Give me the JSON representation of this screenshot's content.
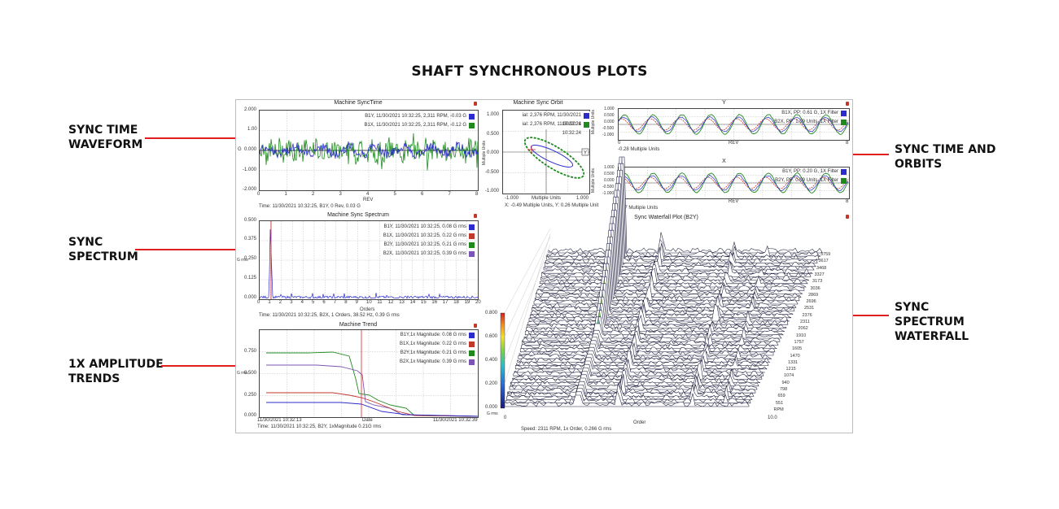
{
  "title": "SHAFT SYNCHRONOUS PLOTS",
  "callouts": {
    "sync_time_waveform": "SYNC TIME\nWAVEFORM",
    "sync_spectrum": "SYNC\nSPECTRUM",
    "amplitude_trends": "1X AMPLITUDE\nTRENDS",
    "sync_time_orbits": "SYNC TIME AND\nORBITS",
    "spectrum_waterfall": "SYNC\nSPECTRUM\nWATERFALL"
  },
  "colors": {
    "accent_line": "#e02020",
    "blue": "#2c2ccc",
    "green": "#1e8a1e",
    "red": "#c0392b",
    "purple": "#7a55b5"
  },
  "sync_time": {
    "title": "Machine SyncTime",
    "y_ticks": [
      "2.000",
      "1.00",
      "0.000",
      "-1.000",
      "-2.000"
    ],
    "x_ticks": [
      "0",
      "1",
      "2",
      "3",
      "4",
      "5",
      "6",
      "7",
      "8"
    ],
    "xlabel": "REV",
    "ylabel": "G",
    "legend": [
      "B1Y, 11/30/2021 10:32:25, 2,311 RPM, -0.03 G",
      "B1X, 11/30/2021 10:32:25, 2,311 RPM, -0.12 G"
    ],
    "status": "Time: 11/30/2021 10:32:25, B1Y, 0 Rev, 0.03 G"
  },
  "sync_spectrum": {
    "title": "Machine Sync Spectrum",
    "y_ticks": [
      "0.500",
      "0.375",
      "0.250",
      "0.125",
      "0.000"
    ],
    "x_ticks": [
      "0",
      "1",
      "2",
      "3",
      "4",
      "5",
      "6",
      "7",
      "8",
      "9",
      "10",
      "11",
      "12",
      "13",
      "14",
      "15",
      "16",
      "17",
      "18",
      "19",
      "20"
    ],
    "xlabel": "Orders",
    "ylabel": "G rms",
    "legend": [
      "B1Y, 11/30/2021 10:32:25, 0.08 G rms",
      "B1X, 11/30/2021 10:32:25, 0.22 G rms",
      "B2Y, 11/30/2021 10:32:25, 0.21 G rms",
      "B2X, 11/30/2021 10:32:25, 0.39 G rms"
    ],
    "status": "Time: 11/30/2021 10:32:25, B2X, 1 Orders, 38.52 Hz, 0.39 G rms"
  },
  "trend": {
    "title": "Machine Trend",
    "y_ticks": [
      "0.750",
      "0.500",
      "0.250",
      "0.000"
    ],
    "xlabel": "Date",
    "ylabel": "G rms",
    "x_start": "11/30/2021 10:32:13",
    "x_end": "11/30/2021 10:32:39",
    "legend": [
      "B1Y,1x Magnitude: 0.08 G rms",
      "B1X,1x Magnitude: 0.22 G rms",
      "B2Y,1x Magnitude: 0.21 G rms",
      "B2X,1x Magnitude: 0.39 G rms"
    ],
    "status": "Time: 11/30/2021 10:32:25, B2Y, 1xMagnitude 0.21G rms"
  },
  "orbit": {
    "title": "Machine Sync Orbit",
    "y_ticks": [
      "1.000",
      "0.500",
      "0.000",
      "-0.500",
      "-1.000"
    ],
    "x_ticks": [
      "-1.000",
      "Multiple Units",
      "1.000"
    ],
    "ylabel": "Multiple Units",
    "legend": [
      "ial: 2,376 RPM, 11/30/2021 10:32:24",
      "ial: 2,376 RPM, 11/30/2021 10:32:24"
    ],
    "status": "X: -0.49 Multiple Units, Y: 0.26 Multiple Unit"
  },
  "probe_y": {
    "title": "Y",
    "y_ticks": [
      "1.000",
      "0.500",
      "0.000",
      "-0.500",
      "-1.000"
    ],
    "x_ticks": [
      "0",
      "REV",
      "8"
    ],
    "ylabel": "Multiple Units",
    "legend": [
      "B1X, PP: 0.61 G, 1X Filter",
      "B2X, PP: 1.09 Units, 1X Filter"
    ],
    "status": "-0.28 Multiple Units"
  },
  "probe_x": {
    "title": "X",
    "y_ticks": [
      "1.000",
      "0.500",
      "0.000",
      "-0.500",
      "-1.000"
    ],
    "x_ticks": [
      "0",
      "REV",
      "8"
    ],
    "ylabel": "Multiple Units",
    "legend": [
      "B1Y, PP: 0.20 G, 1X Filter",
      "B2Y, PP: 0.09 Units, 1X Filter"
    ],
    "status": "0.07 Multiple Units"
  },
  "waterfall": {
    "title": "Sync Waterfall Plot (B2Y)",
    "color_ticks": [
      "0.800",
      "0.600",
      "0.400",
      "0.200",
      "0.000"
    ],
    "bottom_label": "G rms",
    "x_start": "0",
    "x_end": "10.0",
    "xlabel": "Order",
    "rpm_labels": [
      "3759",
      "3617",
      "3468",
      "3327",
      "3173",
      "3036",
      "2869",
      "2696",
      "2531",
      "2376",
      "2311",
      "2062",
      "1910",
      "1757",
      "1605",
      "1470",
      "1331",
      "1215",
      "1074",
      "940",
      "798",
      "659",
      "551",
      "RPM"
    ],
    "status": "Speed: 2311 RPM, 1x Order, 0.266 G rms"
  }
}
